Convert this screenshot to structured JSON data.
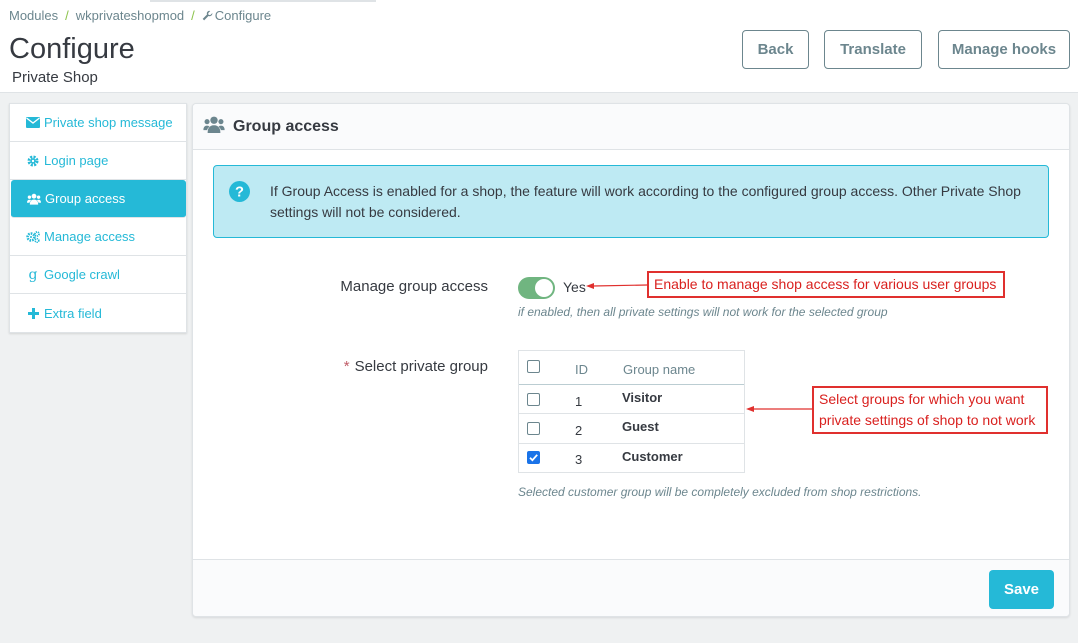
{
  "breadcrumb": {
    "items": [
      "Modules",
      "wkprivateshopmod",
      "Configure"
    ]
  },
  "header": {
    "title": "Configure",
    "subtitle": "Private Shop",
    "buttons": {
      "back": "Back",
      "translate": "Translate",
      "manage_hooks": "Manage hooks"
    }
  },
  "sidebar": {
    "items": [
      {
        "label": "Private shop message",
        "icon": "envelope-icon"
      },
      {
        "label": "Login page",
        "icon": "gear-icon"
      },
      {
        "label": "Group access",
        "icon": "users-icon",
        "active": true
      },
      {
        "label": "Manage access",
        "icon": "gears-icon"
      },
      {
        "label": "Google crawl",
        "icon": "google-icon"
      },
      {
        "label": "Extra field",
        "icon": "plus-icon"
      }
    ]
  },
  "panel": {
    "title": "Group access",
    "alert": "If Group Access is enabled for a shop, the feature will work according to the configured group access. Other Private Shop settings will not be considered.",
    "manage_group_access": {
      "label": "Manage group access",
      "value": "Yes",
      "enabled": true,
      "help": "if enabled, then all private settings will not work for the selected group"
    },
    "select_group": {
      "required_mark": "*",
      "label": "Select private group",
      "columns": [
        "ID",
        "Group name"
      ],
      "rows": [
        {
          "id": "1",
          "name": "Visitor",
          "checked": false
        },
        {
          "id": "2",
          "name": "Guest",
          "checked": false
        },
        {
          "id": "3",
          "name": "Customer",
          "checked": true
        }
      ],
      "help": "Selected customer group will be completely excluded from shop restrictions."
    },
    "save_label": "Save"
  },
  "annotations": {
    "toggle_note": "Enable to manage shop access for various user groups",
    "groups_note": "Select groups for which you want private settings of shop to not work"
  },
  "colors": {
    "accent": "#25b9d7",
    "toggle_on": "#70b580",
    "annotation": "#e0302e"
  }
}
